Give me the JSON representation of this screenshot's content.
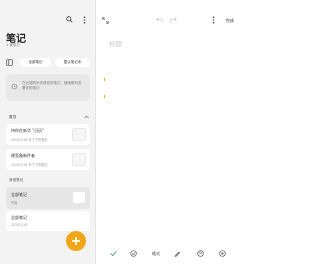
{
  "left": {
    "title": "笔记",
    "subtitle": "4 篇笔记",
    "tabs": [
      "全部笔记",
      "整认笔记本"
    ],
    "sync_notice": "在云端同步完成你的笔记，随地都可查看你的笔记",
    "sections": {
      "pinned": "置顶",
      "other": "其他笔记"
    },
    "notes": [
      {
        "title": "持你在新华 \"日历\"",
        "date": "2020/2/16 写了下的笔记",
        "has_thumb": true
      },
      {
        "title": "便签备新件者",
        "date": "2020/2/16 写了下的笔记",
        "has_thumb": true
      },
      {
        "title": "全部笔记",
        "date": "昨晚",
        "has_thumb": true
      },
      {
        "title": "全部笔记",
        "date": "2020/2/16",
        "has_thumb": false
      }
    ]
  },
  "editor": {
    "done_label": "完成",
    "title_placeholder": "标题",
    "format_label": "格式"
  },
  "colors": {
    "accent": "#f2a71b",
    "panel_bg": "#f3f3f3"
  }
}
